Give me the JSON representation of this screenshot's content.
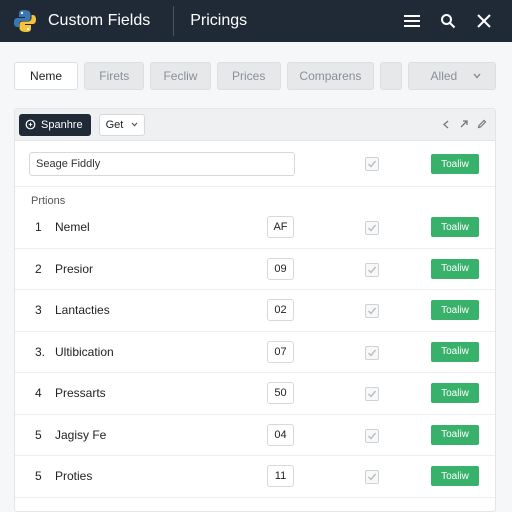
{
  "app": {
    "title": "Custom Fields",
    "page_title": "Pricings"
  },
  "tabs": [
    {
      "label": "Neme",
      "active": true
    },
    {
      "label": "Firets",
      "active": false
    },
    {
      "label": "Fecliw",
      "active": false
    },
    {
      "label": "Prices",
      "active": false
    },
    {
      "label": "Comparens",
      "active": false
    },
    {
      "label": "",
      "active": false
    },
    {
      "label": "Alled",
      "active": false
    }
  ],
  "toolbar": {
    "sparkle_label": "Spanhre",
    "get_label": "Get"
  },
  "search": {
    "value": "Seage Fiddly",
    "button_label": "Toaliw"
  },
  "section_label": "Prtions",
  "rows": [
    {
      "num": "1",
      "name": "Nemel",
      "value": "AF",
      "button": "Toaliw"
    },
    {
      "num": "2",
      "name": "Presior",
      "value": "09",
      "button": "Toaliw"
    },
    {
      "num": "3",
      "name": "Lantacties",
      "value": "02",
      "button": "Toaliw"
    },
    {
      "num": "3.",
      "name": "Ultibication",
      "value": "07",
      "button": "Toaliw"
    },
    {
      "num": "4",
      "name": "Pressarts",
      "value": "50",
      "button": "Toaliw"
    },
    {
      "num": "5",
      "name": "Jagisy Fe",
      "value": "04",
      "button": "Toaliw"
    },
    {
      "num": "5",
      "name": "Proties",
      "value": "11",
      "button": "Toaliw"
    }
  ],
  "colors": {
    "header": "#1f2a36",
    "accent_green": "#38b26a",
    "panel": "#f6f7f8"
  },
  "icons": [
    "python-logo-icon",
    "hamburger-menu-icon",
    "search-icon",
    "close-icon",
    "sparkle-icon",
    "chevron-down-icon",
    "back-icon",
    "share-icon",
    "edit-icon",
    "checkmark-icon"
  ]
}
